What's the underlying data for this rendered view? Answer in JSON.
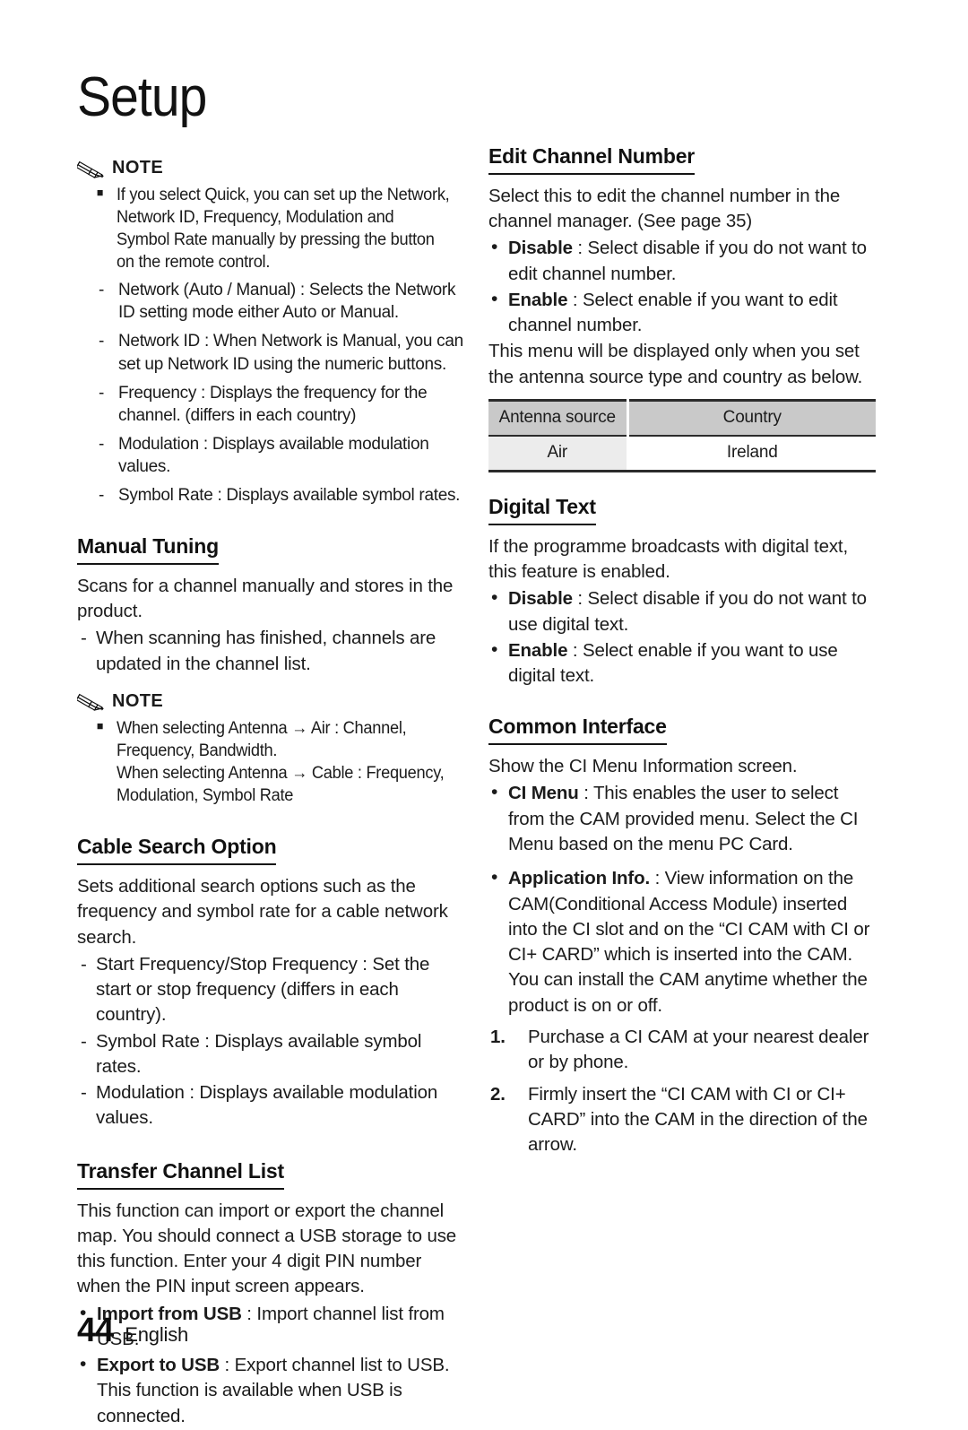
{
  "page": {
    "chapter_title": "Setup",
    "footer_page_number": "44",
    "footer_language": "English"
  },
  "left_column": {
    "note_top": {
      "icon": "pencil-icon",
      "label": "NOTE",
      "items": [
        "If you select Quick, you can set up the Network, Network ID, Frequency, Modulation and Symbol Rate manually by pressing the button on the remote control."
      ],
      "sub_items": [
        "Network (Auto / Manual) : Selects the Network ID setting mode either Auto or Manual.",
        "Network ID : When Network is Manual, you can set up Network ID using the numeric buttons.",
        "Frequency : Displays the frequency for the channel. (differs in each country)",
        "Modulation : Displays available modulation values.",
        "Symbol Rate : Displays available symbol rates."
      ]
    },
    "manual_tuning": {
      "heading": "Manual Tuning",
      "intro": "Scans for a channel manually and stores in the product.",
      "dashes": [
        "When scanning has finished, channels are updated in the channel list."
      ],
      "note": {
        "icon": "pencil-icon",
        "label": "NOTE",
        "item_1": "When selecting Antenna → Air : Channel, Frequency, Bandwidth.",
        "item_1_cont": "When selecting Antenna → Cable : Frequency, Modulation, Symbol Rate"
      }
    },
    "cable_search_option": {
      "heading": "Cable Search Option",
      "intro": "Sets additional search options such as the frequency and symbol rate for a cable network search.",
      "dashes": [
        "Start Frequency/Stop Frequency : Set the start or stop frequency (differs in each country).",
        "Symbol Rate : Displays available symbol rates.",
        "Modulation : Displays available modulation values."
      ]
    },
    "transfer_channel_list": {
      "heading": "Transfer Channel List",
      "intro": "This function can import or export the channel map. You should connect a USB storage to use this function. Enter your 4 digit PIN number when the PIN input screen appears.",
      "bullets": [
        {
          "term": "Import from USB",
          "text": " : Import channel list from USB."
        },
        {
          "term": "Export to USB",
          "text": " : Export channel list to USB. This function is available when USB is connected."
        }
      ]
    }
  },
  "right_column": {
    "edit_channel_number": {
      "heading": "Edit Channel Number",
      "intro": "Select this to edit the channel number in the channel manager. (See page 35)",
      "bullets": [
        {
          "term": "Disable",
          "text": " : Select disable if you do not want to edit channel number."
        },
        {
          "term": "Enable",
          "text": " : Select enable if you want to edit channel number."
        }
      ],
      "outro": "This menu will be displayed only when you set the antenna source type and country as below.",
      "table": {
        "headers": [
          "Antenna source",
          "Country"
        ],
        "rows": [
          [
            "Air",
            "Ireland"
          ]
        ]
      }
    },
    "digital_text": {
      "heading": "Digital Text",
      "intro": "If the programme broadcasts with digital text, this feature is enabled.",
      "bullets": [
        {
          "term": "Disable",
          "text": " : Select disable if you do not want to use digital text."
        },
        {
          "term": "Enable",
          "text": " : Select enable if you want to use digital text."
        }
      ]
    },
    "common_interface": {
      "heading": "Common Interface",
      "intro": "Show the CI Menu Information screen.",
      "bullets": [
        {
          "term": "CI Menu",
          "text": " : This enables the user to select from the CAM provided menu. Select the CI Menu based on the menu PC Card."
        },
        {
          "term": "Application Info.",
          "text": " : View information on the CAM(Conditional Access Module) inserted into the CI slot and on the “CI CAM with CI or CI+ CARD” which is inserted into the CAM. You can install the CAM anytime whether the product is on or off."
        }
      ],
      "steps": [
        {
          "num": "1.",
          "text": "Purchase a CI CAM at your nearest dealer or by phone."
        },
        {
          "num": "2.",
          "text": "Firmly insert the “CI CAM with CI or CI+ CARD” into the CAM in the direction of the arrow."
        }
      ]
    }
  }
}
